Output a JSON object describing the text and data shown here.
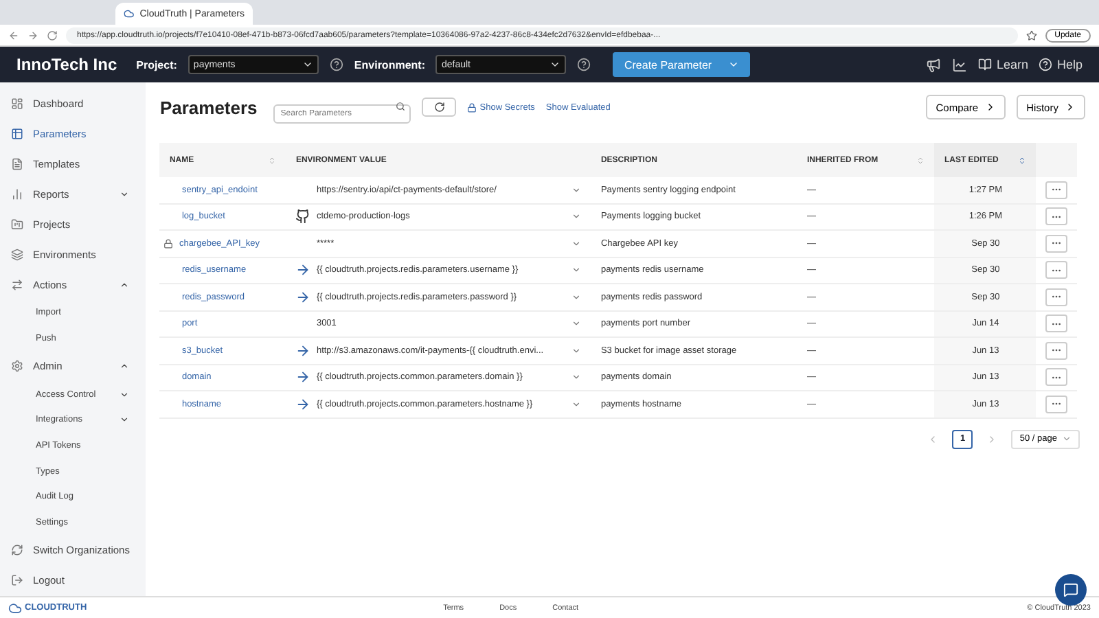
{
  "browser": {
    "tab_title": "CloudTruth | Parameters",
    "url": "https://app.cloudtruth.io/projects/f7e10410-08ef-471b-b873-06fcd7aab605/parameters?template=10364086-97a2-4237-86c8-434efc2d7632&envId=efdbebaa-...",
    "update_label": "Update"
  },
  "header": {
    "org": "InnoTech Inc",
    "project_label": "Project:",
    "project": "payments",
    "environment_label": "Environment:",
    "environment": "default",
    "create_button": "Create Parameter",
    "links": [
      "Learn",
      "Help"
    ]
  },
  "sidebar": {
    "items": [
      {
        "label": "Dashboard",
        "kind": "main",
        "selected": false
      },
      {
        "label": "Parameters",
        "kind": "main",
        "selected": true
      },
      {
        "label": "Templates",
        "kind": "main",
        "selected": false
      },
      {
        "label": "Reports",
        "kind": "main",
        "selected": false,
        "expanded": false
      },
      {
        "label": "Projects",
        "kind": "main",
        "selected": false
      },
      {
        "label": "Environments",
        "kind": "main",
        "selected": false
      },
      {
        "label": "Actions",
        "kind": "main",
        "selected": false,
        "expanded": true
      },
      {
        "label": "Import",
        "kind": "sub",
        "selected": false
      },
      {
        "label": "Push",
        "kind": "sub",
        "selected": false
      },
      {
        "label": "Admin",
        "kind": "main",
        "selected": false,
        "expanded": true
      },
      {
        "label": "Access Control",
        "kind": "sub",
        "selected": false,
        "expanded": false
      },
      {
        "label": "Integrations",
        "kind": "sub",
        "selected": false,
        "expanded": false
      },
      {
        "label": "API Tokens",
        "kind": "sub",
        "selected": false
      },
      {
        "label": "Types",
        "kind": "sub",
        "selected": false
      },
      {
        "label": "Audit Log",
        "kind": "sub",
        "selected": false
      },
      {
        "label": "Settings",
        "kind": "sub",
        "selected": false
      },
      {
        "label": "Switch Organizations",
        "kind": "main",
        "selected": false
      },
      {
        "label": "Logout",
        "kind": "main",
        "selected": false
      }
    ],
    "logo": "CLOUDTRUTH"
  },
  "page": {
    "title": "Parameters",
    "search_placeholder": "Search Parameters",
    "show_secrets": "Show Secrets",
    "show_evaluated": "Show Evaluated",
    "compare": "Compare",
    "history": "History"
  },
  "table": {
    "columns": [
      "NAME",
      "ENVIRONMENT VALUE",
      "DESCRIPTION",
      "INHERITED FROM",
      "LAST EDITED"
    ],
    "rows": [
      {
        "name": "sentry_api_endoint",
        "kind": "plain",
        "secret": false,
        "value": "https://sentry.io/api/ct-payments-default/store/",
        "description": "Payments sentry logging endpoint",
        "inherited": "—",
        "edited": "1:27 PM"
      },
      {
        "name": "log_bucket",
        "kind": "github",
        "secret": false,
        "value": "ctdemo-production-logs",
        "description": "Payments logging bucket",
        "inherited": "—",
        "edited": "1:26 PM"
      },
      {
        "name": "chargebee_API_key",
        "kind": "plain",
        "secret": true,
        "value": "*****",
        "description": "Chargebee API key",
        "inherited": "—",
        "edited": "Sep 30"
      },
      {
        "name": "redis_username",
        "kind": "reference",
        "secret": false,
        "value": "{{ cloudtruth.projects.redis.parameters.username }}",
        "description": "payments redis username",
        "inherited": "—",
        "edited": "Sep 30"
      },
      {
        "name": "redis_password",
        "kind": "reference",
        "secret": false,
        "value": "{{ cloudtruth.projects.redis.parameters.password }}",
        "description": "payments redis password",
        "inherited": "—",
        "edited": "Sep 30"
      },
      {
        "name": "port",
        "kind": "plain",
        "secret": false,
        "value": "3001",
        "description": "payments port number",
        "inherited": "—",
        "edited": "Jun 14"
      },
      {
        "name": "s3_bucket",
        "kind": "reference",
        "secret": false,
        "value": "http://s3.amazonaws.com/it-payments-{{ cloudtruth.envi...",
        "description": "S3 bucket for image asset storage",
        "inherited": "—",
        "edited": "Jun 13"
      },
      {
        "name": "domain",
        "kind": "reference",
        "secret": false,
        "value": "{{ cloudtruth.projects.common.parameters.domain }}",
        "description": "payments domain",
        "inherited": "—",
        "edited": "Jun 13"
      },
      {
        "name": "hostname",
        "kind": "reference",
        "secret": false,
        "value": "{{ cloudtruth.projects.common.parameters.hostname }}",
        "description": "payments hostname",
        "inherited": "—",
        "edited": "Jun 13"
      }
    ]
  },
  "pagination": {
    "pages": [
      {
        "label": "1",
        "selected": true
      }
    ],
    "page_size": "50 / page"
  },
  "footer": {
    "links": [
      "Terms",
      "Docs",
      "Contact"
    ],
    "copyright": "© CloudTruth 2023"
  }
}
